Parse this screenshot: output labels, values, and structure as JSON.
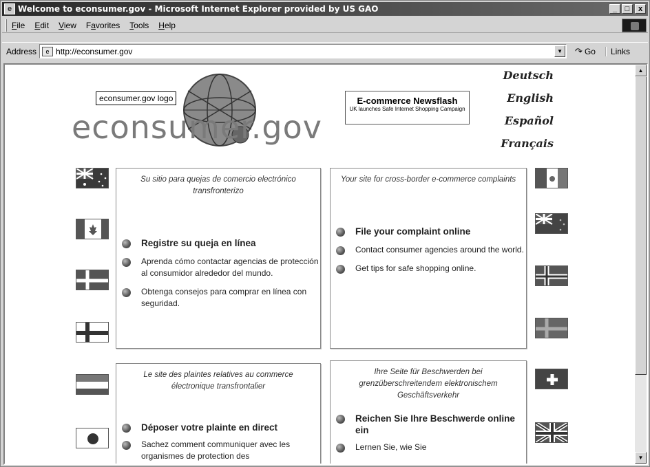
{
  "window": {
    "title": "Welcome to econsumer.gov - Microsoft Internet Explorer provided by US GAO",
    "minimize": "_",
    "restore": "□",
    "close": "x"
  },
  "menu": {
    "items": [
      {
        "u": "F",
        "rest": "ile"
      },
      {
        "u": "E",
        "rest": "dit"
      },
      {
        "u": "V",
        "rest": "iew"
      },
      {
        "pre": "F",
        "u": "a",
        "rest": "vorites"
      },
      {
        "u": "T",
        "rest": "ools"
      },
      {
        "u": "H",
        "rest": "elp"
      }
    ]
  },
  "address": {
    "label": "Address",
    "url": "http://econsumer.gov",
    "go": "Go",
    "links": "Links"
  },
  "logo": {
    "alt_text": "econsumer.gov logo",
    "wordmark": "econsumer.gov"
  },
  "newsflash": {
    "title": "E-commerce Newsflash",
    "text": "UK launches Safe Internet Shopping Campaign"
  },
  "languages": [
    "Deutsch",
    "English",
    "Español",
    "Français"
  ],
  "panels": {
    "es": {
      "heading": "Su sitio para quejas de comercio electrónico transfronterizo",
      "primary": "Registre su queja en línea",
      "items": [
        "Aprenda cómo contactar agencias de protección al consumidor alrededor del mundo.",
        "Obtenga consejos para comprar en línea con seguridad."
      ]
    },
    "en": {
      "heading": "Your site for cross-border e-commerce complaints",
      "primary": "File your complaint online",
      "items": [
        "Contact consumer agencies around the world.",
        "Get tips for safe shopping online."
      ]
    },
    "fr": {
      "heading": "Le site des plaintes relatives au commerce électronique transfrontalier",
      "primary": "Déposer votre plainte en direct",
      "items": [
        "Sachez comment communiquer avec les organismes de protection des"
      ]
    },
    "de": {
      "heading": "Ihre Seite für Beschwerden bei grenzüberschreitendem elektronischem Geschäftsverkehr",
      "primary": "Reichen Sie Ihre Beschwerde online ein",
      "items": [
        "Lernen Sie, wie Sie"
      ]
    }
  },
  "flags": {
    "left": [
      "australia-flag",
      "canada-flag",
      "denmark-flag",
      "finland-flag",
      "hungary-flag",
      "japan-flag"
    ],
    "right": [
      "mexico-flag",
      "new-zealand-flag",
      "norway-flag",
      "sweden-flag",
      "switzerland-flag",
      "uk-flag"
    ]
  },
  "colors": {
    "titlebar_start": "#2a2a2a",
    "titlebar_end": "#6a6a6a",
    "chrome": "#d4d4d4",
    "wordmark": "#7a7a7a"
  }
}
